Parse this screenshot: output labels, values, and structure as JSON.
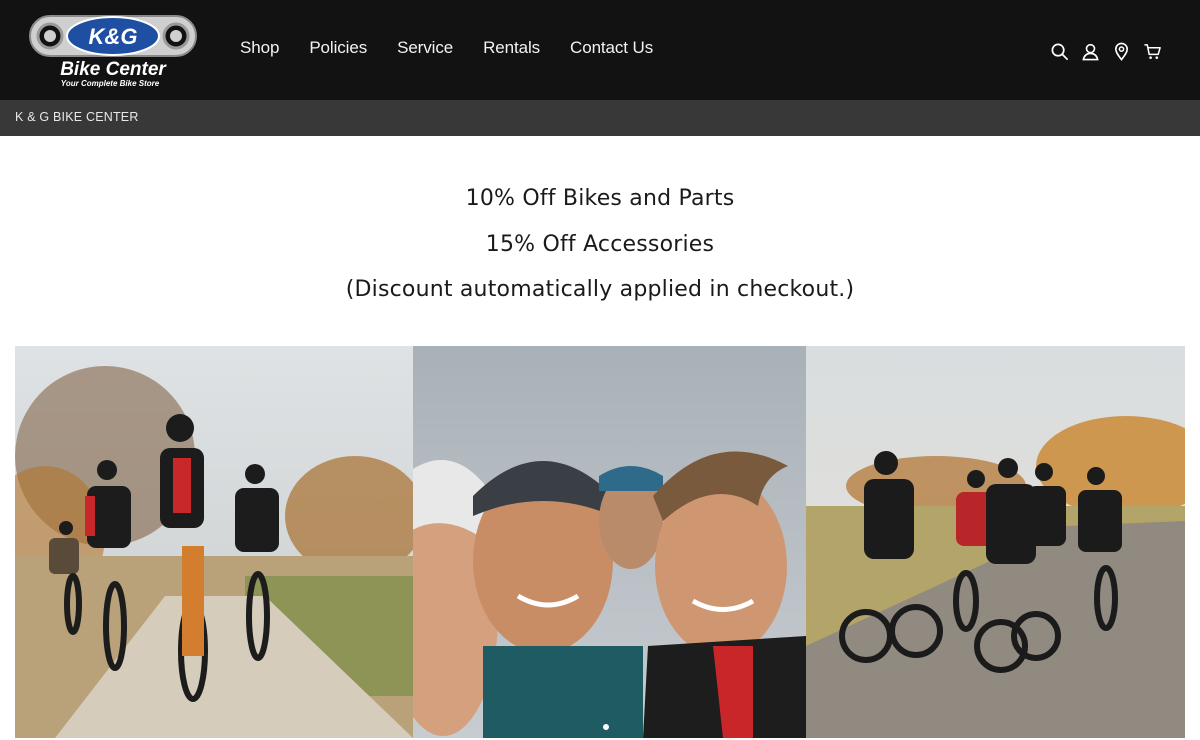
{
  "header": {
    "logo": {
      "brand_short": "K&G",
      "brand_name": "Bike Center",
      "tagline": "Your Complete Bike Store"
    },
    "nav": [
      {
        "label": "Shop"
      },
      {
        "label": "Policies"
      },
      {
        "label": "Service"
      },
      {
        "label": "Rentals"
      },
      {
        "label": "Contact Us"
      }
    ],
    "icons": [
      "search-icon",
      "account-icon",
      "location-icon",
      "cart-icon"
    ]
  },
  "subbar": {
    "label": "K & G BIKE CENTER"
  },
  "promo": {
    "line1": "10% Off Bikes and Parts",
    "line2": "15% Off Accessories",
    "line3": "(Discount automatically applied in checkout.)"
  },
  "gallery": {
    "images": [
      "group-ride-trail-photo",
      "riders-selfie-photo",
      "group-ride-road-photo"
    ],
    "active_slide": 1
  },
  "colors": {
    "header_bg": "#121212",
    "subbar_bg": "#383838",
    "logo_blue": "#1e4fa3"
  }
}
